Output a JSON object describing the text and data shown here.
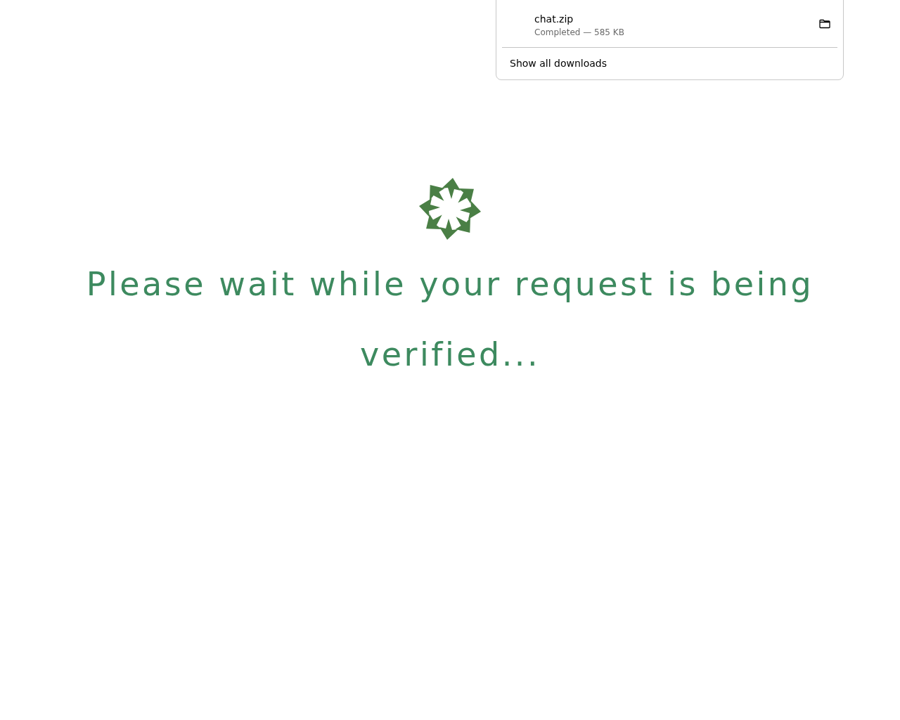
{
  "downloads_panel": {
    "items": [
      {
        "filename": "chat.zip",
        "status": "Completed — 585 KB"
      }
    ],
    "show_all": "Show all downloads"
  },
  "message": "Please wait while your request is being verified..."
}
